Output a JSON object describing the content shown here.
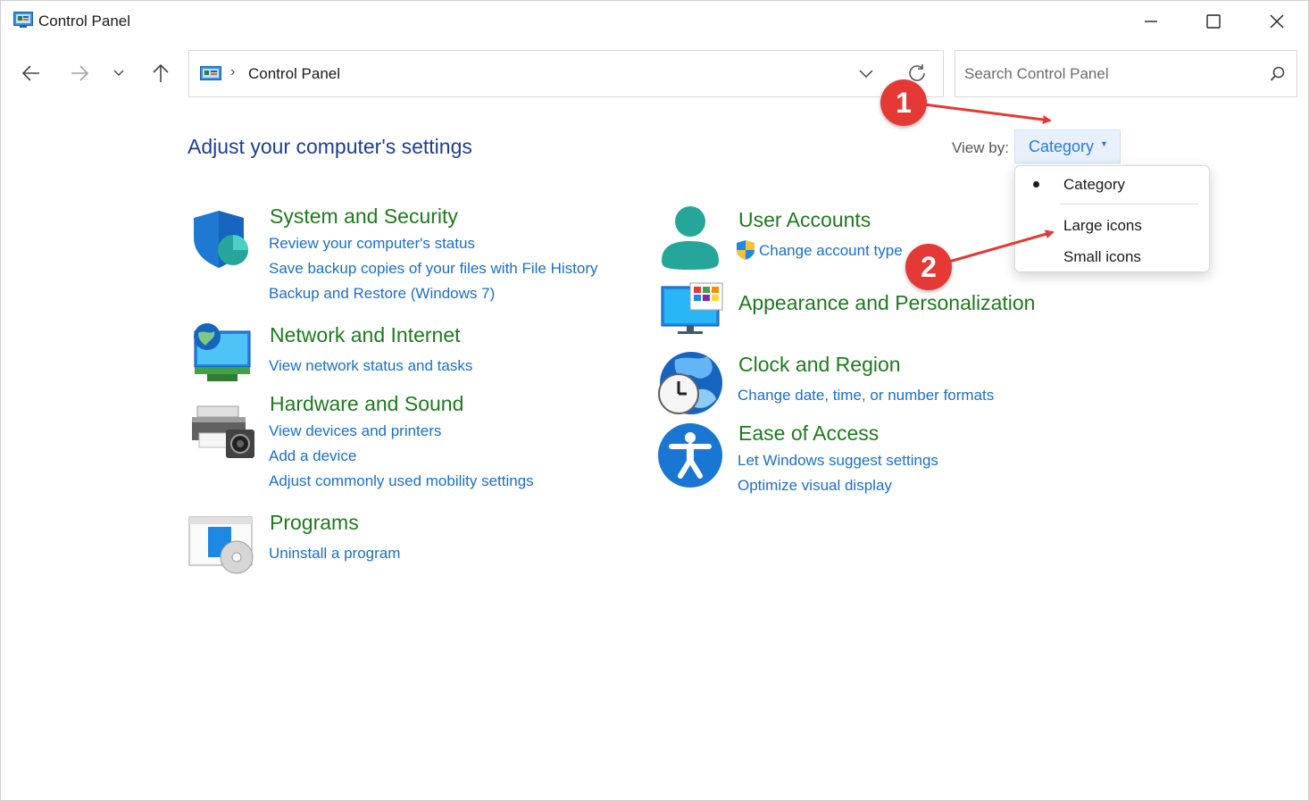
{
  "window": {
    "title": "Control Panel"
  },
  "address": {
    "breadcrumb": "Control Panel",
    "separator": "›"
  },
  "search": {
    "placeholder": "Search Control Panel"
  },
  "header": {
    "title": "Adjust your computer's settings",
    "view_by_label": "View by:",
    "view_by_value": "Category"
  },
  "view_menu": {
    "items": [
      "Category",
      "Large icons",
      "Small icons"
    ],
    "selected": "Category"
  },
  "categories": {
    "system": {
      "title": "System and Security",
      "links": [
        "Review your computer's status",
        "Save backup copies of your files with File History",
        "Backup and Restore (Windows 7)"
      ]
    },
    "network": {
      "title": "Network and Internet",
      "links": [
        "View network status and tasks"
      ]
    },
    "hardware": {
      "title": "Hardware and Sound",
      "links": [
        "View devices and printers",
        "Add a device",
        "Adjust commonly used mobility settings"
      ]
    },
    "programs": {
      "title": "Programs",
      "links": [
        "Uninstall a program"
      ]
    },
    "users": {
      "title": "User Accounts",
      "links": [
        "Change account type"
      ]
    },
    "appearance": {
      "title": "Appearance and Personalization",
      "links": []
    },
    "clock": {
      "title": "Clock and Region",
      "links": [
        "Change date, time, or number formats"
      ]
    },
    "ease": {
      "title": "Ease of Access",
      "links": [
        "Let Windows suggest settings",
        "Optimize visual display"
      ]
    }
  },
  "annotations": {
    "step1": "1",
    "step2": "2"
  },
  "colors": {
    "title_green": "#1e7a1e",
    "link_blue": "#1a6fc9",
    "heading_blue": "#1e3f8f",
    "badge_red": "#e53935"
  }
}
